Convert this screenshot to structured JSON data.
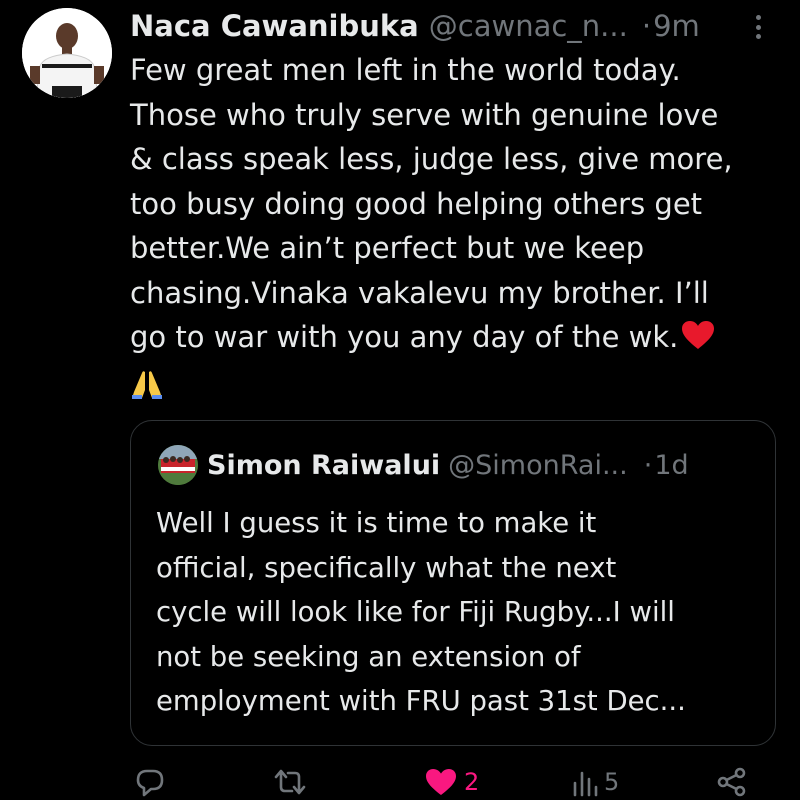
{
  "tweet": {
    "author_name": "Naca Cawanibuka",
    "author_handle": "@cawnac_n...",
    "separator": "·",
    "time": "9m",
    "body_lines": [
      "Few great men left in the world today.",
      "Those who truly serve with genuine love",
      "& class speak less, judge less, give more,",
      "too busy doing good helping others get",
      "better.We ain’t perfect but we keep",
      "chasing.Vinaka vakalevu my brother. I’ll",
      "go to war with you any day of the wk."
    ]
  },
  "quote": {
    "author_name": "Simon Raiwalui",
    "author_handle": "@SimonRai...",
    "separator": "·",
    "time": "1d",
    "body_lines": [
      "Well I guess it is time to make it",
      "official, specifically what the next",
      "cycle will look like for Fiji Rugby...I will",
      "not be seeking an extension of",
      "employment with FRU past 31st Dec..."
    ]
  },
  "actions": {
    "reply_icon": "reply-icon",
    "retweet_icon": "retweet-icon",
    "like_icon": "heart-filled-icon",
    "like_count": "2",
    "views_icon": "views-icon",
    "views_count": "5",
    "share_icon": "share-icon"
  },
  "colors": {
    "background": "#000000",
    "text_primary": "#e7e9ea",
    "text_secondary": "#71767b",
    "like_pink": "#f91880",
    "border": "#2f3336"
  }
}
